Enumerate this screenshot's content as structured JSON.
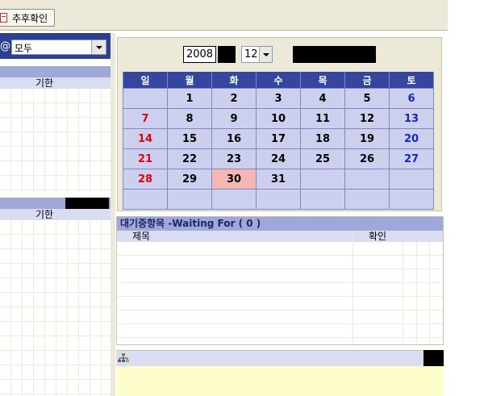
{
  "toolbar": {
    "confirm_label": "추후확인"
  },
  "left": {
    "filter_value": "모두",
    "list1": {
      "col_deadline": "기한"
    },
    "list2": {
      "col_deadline": "기한"
    }
  },
  "calendar": {
    "year": "2008",
    "month": "12",
    "weekdays": [
      "일",
      "월",
      "화",
      "수",
      "목",
      "금",
      "토"
    ],
    "weeks": [
      [
        "",
        "1",
        "2",
        "3",
        "4",
        "5",
        "6"
      ],
      [
        "7",
        "8",
        "9",
        "10",
        "11",
        "12",
        "13"
      ],
      [
        "14",
        "15",
        "16",
        "17",
        "18",
        "19",
        "20"
      ],
      [
        "21",
        "22",
        "23",
        "24",
        "25",
        "26",
        "27"
      ],
      [
        "28",
        "29",
        "30",
        "31",
        "",
        "",
        ""
      ],
      [
        "",
        "",
        "",
        "",
        "",
        "",
        ""
      ]
    ],
    "today": "30",
    "colors": {
      "header": "#3446a0",
      "cell": "#ccd0ee",
      "sunday": "#e4000f",
      "saturday": "#1026c8",
      "today": "#f5b7b3"
    }
  },
  "waiting": {
    "title": "대기중항목 -Waiting For ( 0 )",
    "col_subject": "제목",
    "col_confirm": "확인"
  },
  "icons": {
    "toolbar": "note-page-icon",
    "bottom": "org-chart-icon"
  }
}
